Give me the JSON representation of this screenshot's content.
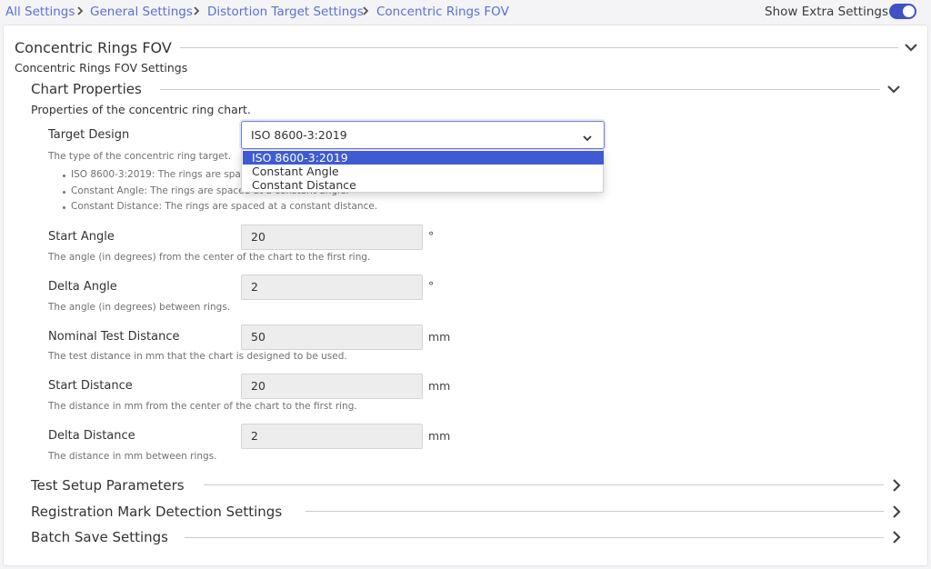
{
  "breadcrumb": [
    {
      "label": "All Settings"
    },
    {
      "label": "General Settings"
    },
    {
      "label": "Distortion Target Settings"
    },
    {
      "label": "Concentric Rings FOV"
    }
  ],
  "show_extra_settings": {
    "label": "Show Extra Settings",
    "on": true
  },
  "section": {
    "title": "Concentric Rings FOV",
    "subtitle": "Concentric Rings FOV Settings",
    "icon": "chevron-down-icon"
  },
  "chart_properties": {
    "title": "Chart Properties",
    "description": "Properties of the concentric ring chart.",
    "target_design": {
      "label": "Target Design",
      "value": "ISO 8600-3:2019",
      "options": [
        "ISO 8600-3:2019",
        "Constant Angle",
        "Constant Distance"
      ],
      "help": "The type of the concentric ring target.",
      "bullets": [
        "ISO 8600-3:2019: The rings are spac",
        "Constant Angle: The rings are spaced at a constant angle.",
        "Constant Distance: The rings are spaced at a constant distance."
      ]
    },
    "fields": [
      {
        "label": "Start Angle",
        "value": "20",
        "unit": "°",
        "help": "The angle (in degrees) from the center of the chart to the first ring."
      },
      {
        "label": "Delta Angle",
        "value": "2",
        "unit": "°",
        "help": "The angle (in degrees) between rings."
      },
      {
        "label": "Nominal Test Distance",
        "value": "50",
        "unit": "mm",
        "help": "The test distance in mm that the chart is designed to be used."
      },
      {
        "label": "Start Distance",
        "value": "20",
        "unit": "mm",
        "help": "The distance in mm from the center of the chart to the first ring."
      },
      {
        "label": "Delta Distance",
        "value": "2",
        "unit": "mm",
        "help": "The distance in mm between rings."
      }
    ]
  },
  "collapsed_sections": [
    {
      "title": "Test Setup Parameters"
    },
    {
      "title": "Registration Mark Detection Settings"
    },
    {
      "title": "Batch Save Settings"
    }
  ],
  "colors": {
    "accent": "#3f51c4",
    "link": "#5b6fd4",
    "selected_option": "#3f5bd4"
  }
}
